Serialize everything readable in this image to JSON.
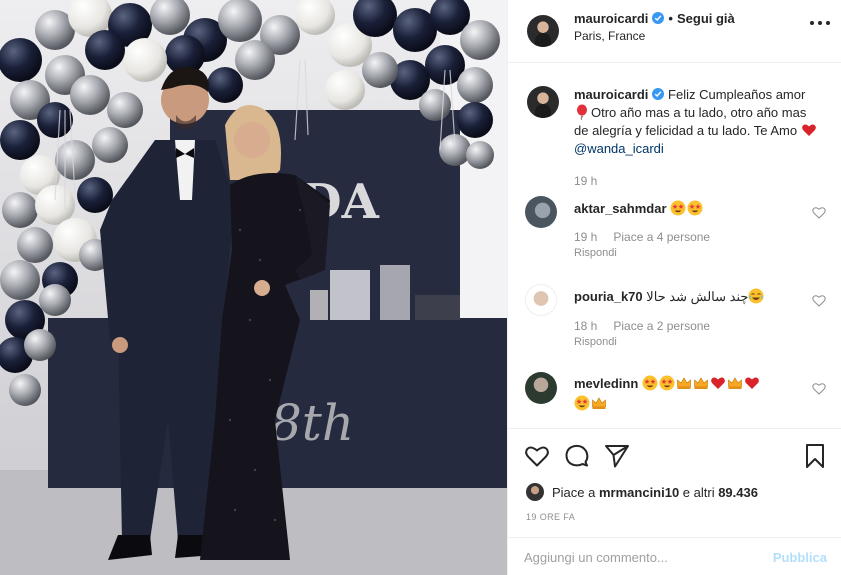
{
  "post": {
    "header": {
      "username": "mauroicardi",
      "verified": true,
      "separator": "•",
      "follow_label": "Segui già",
      "location": "Paris, France"
    },
    "caption": {
      "username": "mauroicardi",
      "text_part1": "Feliz Cumpleaños amor",
      "text_part2": "Otro año mas a tu lado, otro año mas de alegría y felicidad a tu lado. Te Amo",
      "mention": "@wanda_icardi",
      "time": "19 h"
    },
    "comments": [
      {
        "username": "aktar_sahmdar",
        "text": "",
        "emojis": [
          "star-struck-icon",
          "star-struck-icon"
        ],
        "time": "19 h",
        "likes": "Piace a 4 persone",
        "reply": "Rispondi"
      },
      {
        "username": "pouria_k70",
        "text": "چند سالش شد حالا",
        "emojis": [
          "tears-of-joy-icon"
        ],
        "time": "18 h",
        "likes": "Piace a 2 persone",
        "reply": "Rispondi"
      },
      {
        "username": "mevledinn",
        "text": "",
        "emojis": [
          "star-struck-icon",
          "star-struck-icon",
          "crown-icon",
          "crown-icon",
          "heart-icon",
          "crown-icon",
          "heart-icon",
          "star-struck-icon",
          "crown-icon"
        ],
        "time": "",
        "likes": "",
        "reply": ""
      }
    ],
    "likes": {
      "prefix": "Piace a ",
      "user": "mrmancini10",
      "suffix": " e altri ",
      "count": "89.436"
    },
    "timestamp": "19 ORE FA",
    "add_comment": {
      "placeholder": "Aggiungi un commento...",
      "post_label": "Pubblica"
    }
  },
  "photo": {
    "sign_letters": "DA",
    "cake_text": "8th"
  },
  "colors": {
    "verified": "#3897f0",
    "link": "#003569",
    "meta": "#8e8e8e",
    "publish_disabled": "#b2dffc",
    "heart": "#ed4956"
  }
}
